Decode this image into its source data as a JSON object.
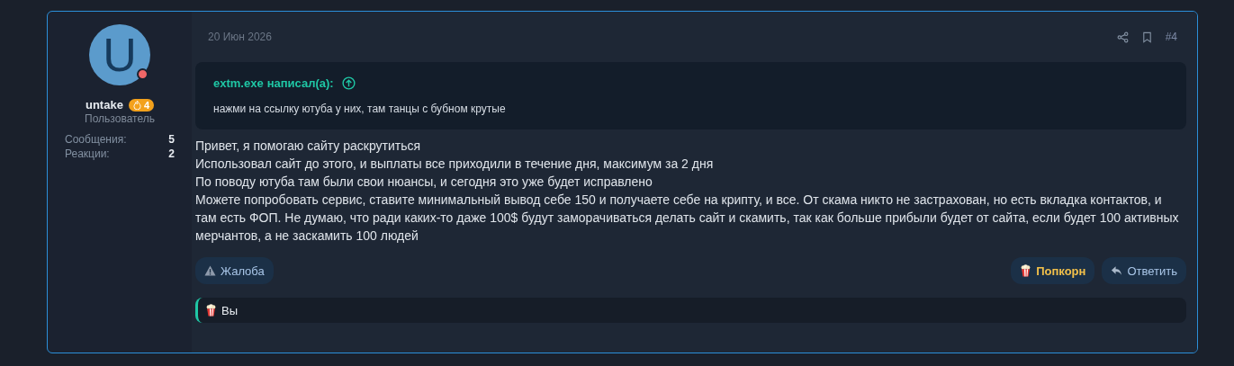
{
  "author": {
    "avatar_letter": "U",
    "online": true,
    "name": "untake",
    "badge": "4",
    "role": "Пользователь",
    "stats": [
      {
        "label": "Сообщения:",
        "value": "5"
      },
      {
        "label": "Реакции:",
        "value": "2"
      }
    ]
  },
  "post": {
    "date": "20 Июн 2026",
    "number": "#4",
    "quote": {
      "author": "extm.exe",
      "suffix": "написал(а):",
      "text": "нажми на ссылку ютуба у них, там танцы с бубном крутые"
    },
    "lines": [
      "Привет, я помогаю сайту раскрутиться",
      "Использовал сайт до этого, и выплаты все приходили в течение дня, максимум за 2 дня",
      "По поводу ютуба там были свои нюансы, и сегодня это уже будет исправлено",
      "Можете попробовать сервис, ставите минимальный вывод себе 150 и получаете себе на крипту, и все. От скама никто не застрахован, но есть вкладка контактов, и там есть ФОП. Не думаю, что ради каких-то даже 100$ будут заморачиваться делать сайт и скамить, так как больше прибыли будет от сайта, если будет 100 активных мерчантов, а не заскамить 100 людей"
    ],
    "actions_left": [
      {
        "label": "Жалоба",
        "kind": "report"
      }
    ],
    "actions_right": [
      {
        "label": "Попкорн",
        "kind": "popcorn",
        "selected": true
      },
      {
        "label": "Ответить",
        "kind": "reply",
        "selected": false
      }
    ],
    "reactions": {
      "text": "Вы"
    }
  }
}
